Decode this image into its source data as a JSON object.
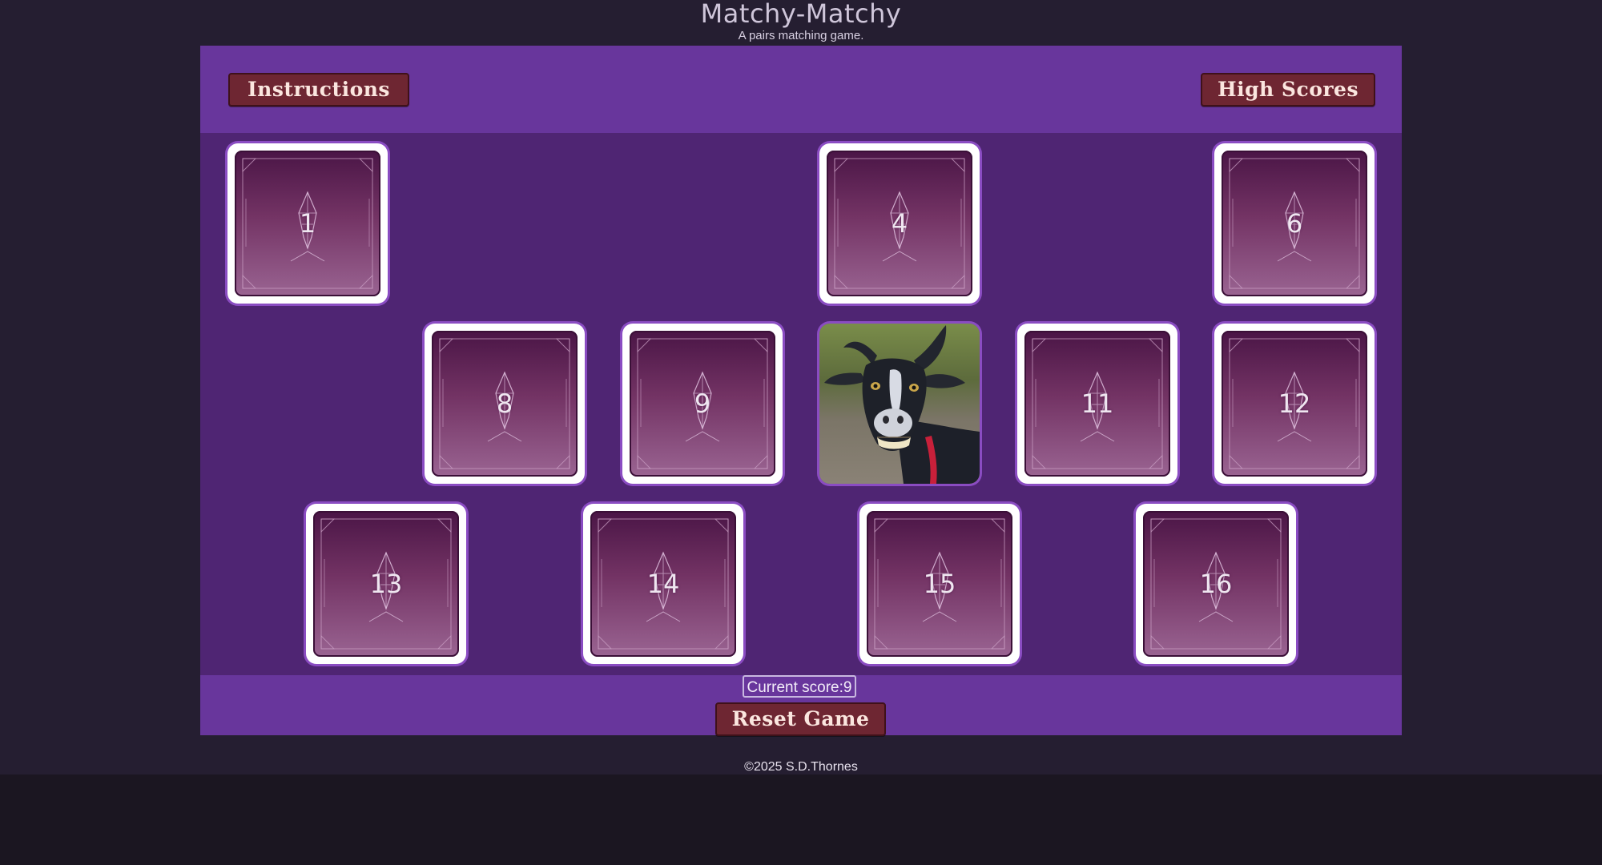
{
  "header": {
    "title": "Matchy-Matchy",
    "subtitle": "A pairs matching game."
  },
  "toolbar": {
    "instructions_label": "Instructions",
    "high_scores_label": "High Scores"
  },
  "cards": [
    {
      "label": "1",
      "state": "face-down"
    },
    {
      "label": "4",
      "state": "face-down"
    },
    {
      "label": "6",
      "state": "face-down"
    },
    {
      "label": "8",
      "state": "face-down"
    },
    {
      "label": "9",
      "state": "face-down"
    },
    {
      "label": "",
      "state": "face-up",
      "image": "goat"
    },
    {
      "label": "11",
      "state": "face-down"
    },
    {
      "label": "12",
      "state": "face-down"
    },
    {
      "label": "13",
      "state": "face-down"
    },
    {
      "label": "14",
      "state": "face-down"
    },
    {
      "label": "15",
      "state": "face-down"
    },
    {
      "label": "16",
      "state": "face-down"
    }
  ],
  "score": {
    "label": "Current score:",
    "value": "9"
  },
  "reset_label": "Reset Game",
  "footer": "©2025 S.D.Thornes",
  "colors": {
    "page_background": "#251e31",
    "frame_background": "#4f2573",
    "bar_background": "#68369c",
    "button_background": "#6e2632",
    "card_border": "#ffffff"
  }
}
